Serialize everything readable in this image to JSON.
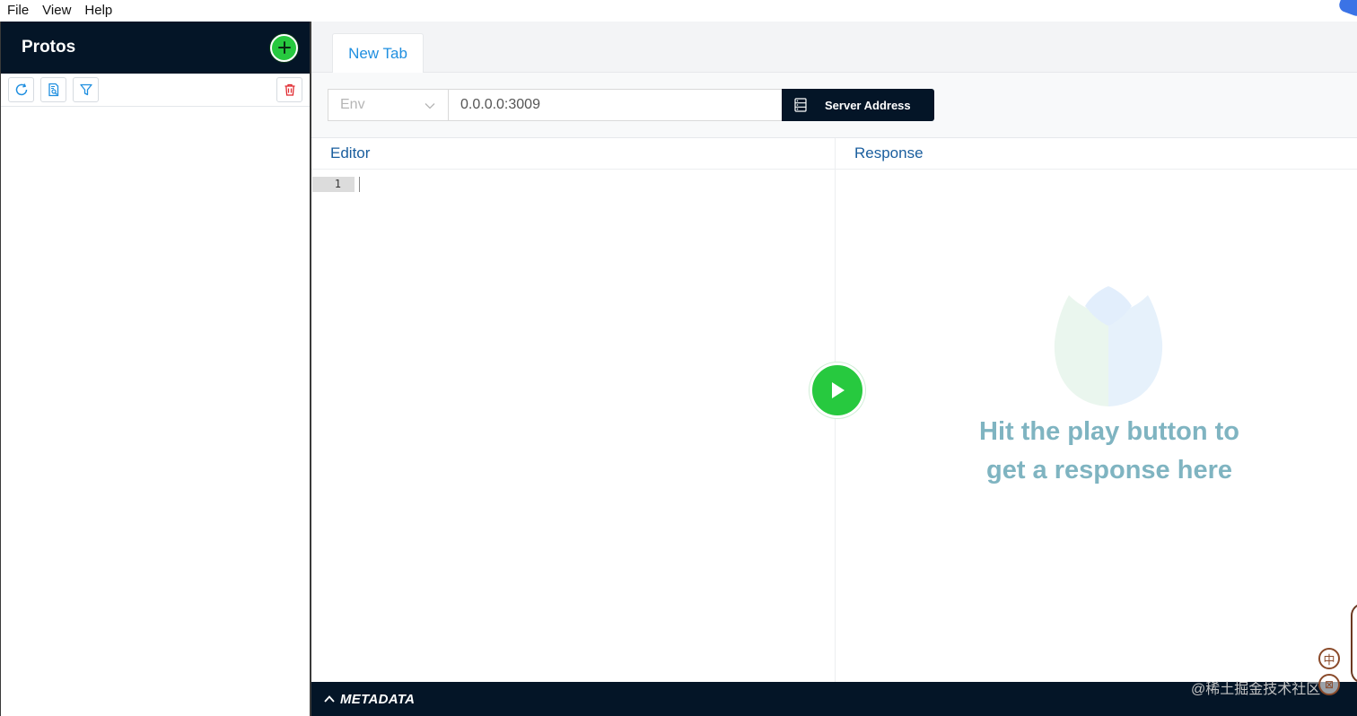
{
  "menubar": {
    "file": "File",
    "view": "View",
    "help": "Help"
  },
  "sidebar": {
    "title": "Protos",
    "add_icon": "plus-icon",
    "toolbar": [
      {
        "icon": "reload-icon"
      },
      {
        "icon": "file-search-icon"
      },
      {
        "icon": "filter-icon"
      },
      {
        "icon": "delete-icon"
      }
    ]
  },
  "tabs": [
    {
      "label": "New Tab"
    }
  ],
  "address": {
    "env_placeholder": "Env",
    "url_value": "0.0.0.0:3009",
    "server_button_label": "Server Address"
  },
  "editor": {
    "title": "Editor",
    "line_numbers": [
      "1"
    ]
  },
  "response": {
    "title": "Response",
    "hint": "Hit the play button to get a response here"
  },
  "metadata": {
    "label": "METADATA"
  },
  "overlay": {
    "watermark": "@稀土掘金技术社区",
    "mascot_char_1": "中",
    "mascot_char_2": "⊠"
  },
  "colors": {
    "dark_navy": "#041527",
    "accent_green": "#27c93f",
    "link_blue": "#1f8fe0",
    "pane_title": "#1a5e9e",
    "hint_text": "#7fb4c1",
    "danger_red": "#e0282e"
  }
}
